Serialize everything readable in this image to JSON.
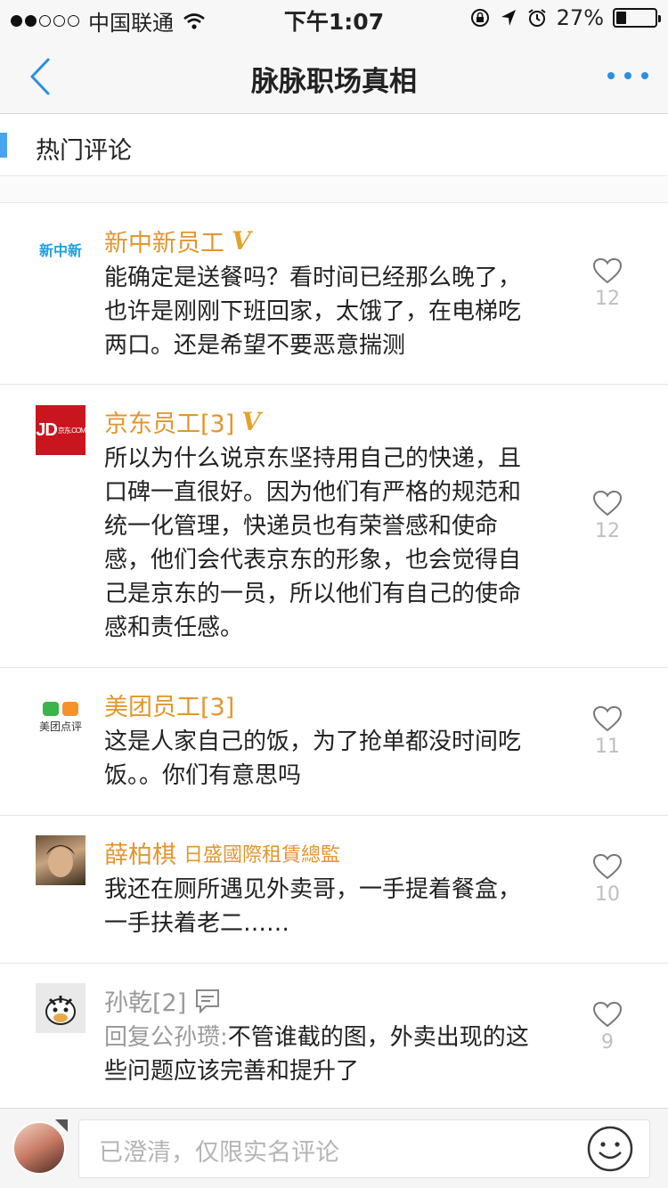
{
  "status_bar": {
    "carrier": "中国联通",
    "time": "下午1:07",
    "battery": "27%",
    "battery_fraction": 0.27
  },
  "nav": {
    "title": "脉脉职场真相"
  },
  "section": {
    "title": "热门评论"
  },
  "comments": [
    {
      "name": "新中新员工",
      "verified": "V",
      "avatar_text": "新中新",
      "text": "能确定是送餐吗？看时间已经那么晚了，也许是刚刚下班回家，太饿了，在电梯吃两口。还是希望不要恶意揣测",
      "likes": "12"
    },
    {
      "name": "京东员工[3]",
      "verified": "V",
      "avatar_text": "JD",
      "avatar_small": "京东.COM",
      "text": "所以为什么说京东坚持用自己的快递，且口碑一直很好。因为他们有严格的规范和统一化管理，快递员也有荣誉感和使命感，他们会代表京东的形象，也会觉得自己是京东的一员，所以他们有自己的使命感和责任感。",
      "likes": "12"
    },
    {
      "name": "美团员工[3]",
      "avatar_text": "美团点评",
      "text": "这是人家自己的饭，为了抢单都没时间吃饭。。你们有意思吗",
      "likes": "11"
    },
    {
      "name": "薛柏棋",
      "company": "日盛國際租賃總監",
      "text": "我还在厕所遇见外卖哥，一手提着餐盒，一手扶着老二……",
      "likes": "10"
    },
    {
      "name": "孙乾[2]",
      "reply_prefix": "回复公孙瓒:",
      "text": "不管谁截的图，外卖出现的这些问题应该完善和提升了",
      "likes": "9"
    }
  ],
  "input": {
    "placeholder": "已澄清，仅限实名评论"
  },
  "colors": {
    "accent": "#2a8fe0",
    "name": "#e3962d",
    "jd_red": "#c9151e"
  }
}
